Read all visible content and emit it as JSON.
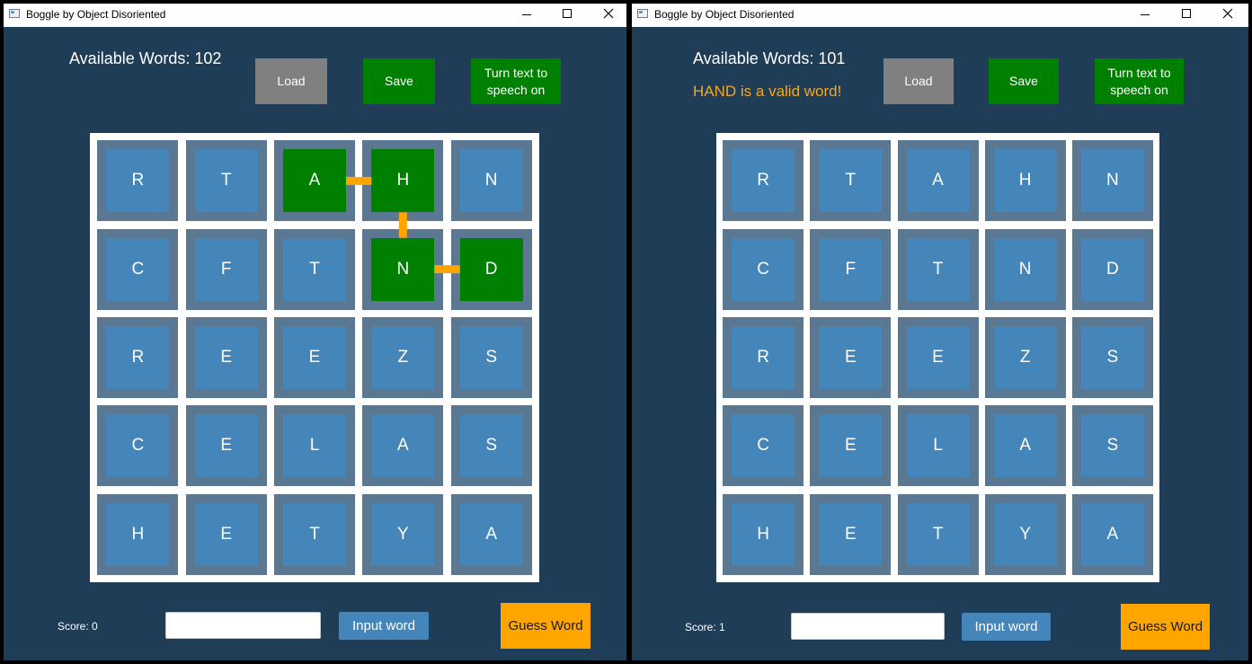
{
  "windows": [
    {
      "title": "Boggle by Object Disoriented",
      "available_words": "Available Words: 102",
      "message": "",
      "buttons": {
        "load": "Load",
        "save": "Save",
        "tts": "Turn text to speech on"
      },
      "grid": [
        [
          "R",
          "T",
          "A",
          "H",
          "N"
        ],
        [
          "C",
          "F",
          "T",
          "N",
          "D"
        ],
        [
          "R",
          "E",
          "E",
          "Z",
          "S"
        ],
        [
          "C",
          "E",
          "L",
          "A",
          "S"
        ],
        [
          "H",
          "E",
          "T",
          "Y",
          "A"
        ]
      ],
      "selected_path": [
        [
          0,
          2
        ],
        [
          0,
          3
        ],
        [
          1,
          3
        ],
        [
          1,
          4
        ]
      ],
      "score": "Score: 0",
      "input_value": "",
      "input_button": "Input word",
      "guess_button": "Guess Word"
    },
    {
      "title": "Boggle by Object Disoriented",
      "available_words": "Available Words: 101",
      "message": "HAND is a valid word!",
      "buttons": {
        "load": "Load",
        "save": "Save",
        "tts": "Turn text to speech on"
      },
      "grid": [
        [
          "R",
          "T",
          "A",
          "H",
          "N"
        ],
        [
          "C",
          "F",
          "T",
          "N",
          "D"
        ],
        [
          "R",
          "E",
          "E",
          "Z",
          "S"
        ],
        [
          "C",
          "E",
          "L",
          "A",
          "S"
        ],
        [
          "H",
          "E",
          "T",
          "Y",
          "A"
        ]
      ],
      "selected_path": [],
      "score": "Score: 1",
      "input_value": "",
      "input_button": "Input word",
      "guess_button": "Guess Word"
    }
  ],
  "colors": {
    "background": "#1f3d57",
    "tile": "#4486ba",
    "tile_border": "#5b7893",
    "selected_tile": "#008000",
    "path_line": "#ffa500",
    "message": "#f5a623",
    "load_button": "#808080",
    "save_button": "#008000",
    "guess_button": "#ffa500"
  },
  "icons": {
    "app": "window-app-icon",
    "minimize": "minimize-icon",
    "maximize": "maximize-icon",
    "close": "close-icon"
  }
}
